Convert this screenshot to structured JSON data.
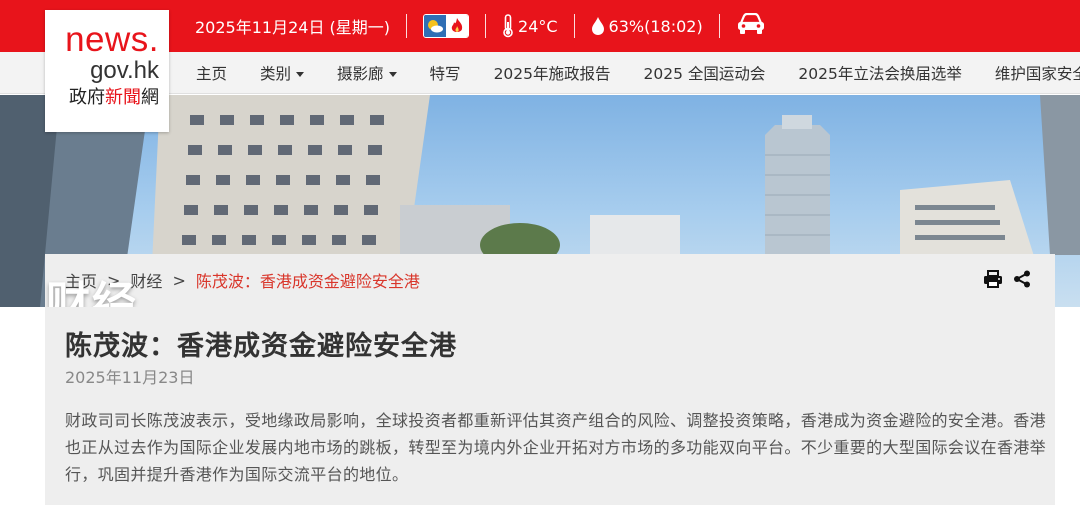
{
  "topbar": {
    "date": "2025年11月24日 (星期一)",
    "weather_icon": "sunny-fire-weather-icon",
    "temperature": "24°C",
    "humidity": "63%(18:02)",
    "traffic_icon": "car-icon",
    "background": "#e8141b"
  },
  "logo": {
    "line1": "news.",
    "line2": "gov.hk",
    "line3_a": "政府",
    "line3_b": "新聞",
    "line3_c": "網"
  },
  "nav": {
    "items": [
      {
        "label": "主页"
      },
      {
        "label": "类别"
      },
      {
        "label": "摄影廊"
      },
      {
        "label": "特写"
      },
      {
        "label": "2025年施政报告"
      },
      {
        "label": "2025 全国运动会"
      },
      {
        "label": "2025年立法会换届选举"
      },
      {
        "label": "维护国家安全"
      }
    ]
  },
  "banner": {
    "title": "财经"
  },
  "breadcrumb": {
    "home": "主页",
    "sep1": ">",
    "category": "财经",
    "sep2": ">",
    "current": "陈茂波：香港成资金避险安全港"
  },
  "tools": {
    "print_icon": "print-icon",
    "share_icon": "share-icon"
  },
  "article": {
    "title": "陈茂波：香港成资金避险安全港",
    "date": "2025年11月23日",
    "body": "财政司司长陈茂波表示，受地缘政局影响，全球投资者都重新评估其资产组合的风险、调整投资策略，香港成为资金避险的安全港。香港也正从过去作为国际企业发展内地市场的跳板，转型至为境内外企业开拓对方市场的多功能双向平台。不少重要的大型国际会议在香港举行，巩固并提升香港作为国际交流平台的地位。"
  },
  "colors": {
    "accent_red": "#e8141b",
    "breadcrumb_current": "#d9362b",
    "card_bg": "#eeeeee"
  }
}
